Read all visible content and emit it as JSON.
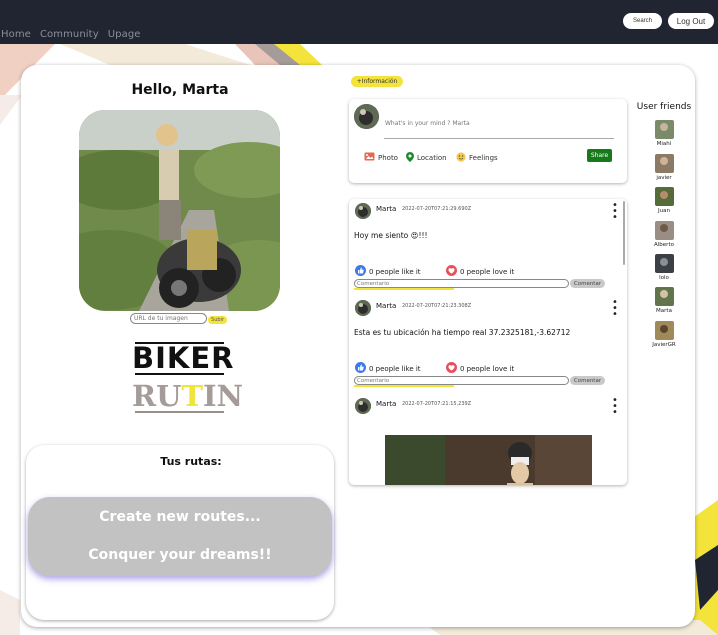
{
  "nav": {
    "links": [
      "Home",
      "Community",
      "Upage"
    ],
    "search_label": "Search",
    "logout_label": "Log Out"
  },
  "profile": {
    "greeting": "Hello, Marta",
    "url_placeholder": "URL de tu imagen",
    "upload_label": "Subir",
    "logo_top": "BIKER",
    "logo_bottom_a": "RU",
    "logo_bottom_b": "T",
    "logo_bottom_c": "IN"
  },
  "routes": {
    "title": "Tus rutas:",
    "cta_line1": "Create new routes...",
    "cta_line2": "Conquer your dreams!!"
  },
  "composer": {
    "info_label": "+Información",
    "placeholder": "What's in your mind ? Marta",
    "photo_label": "Photo",
    "location_label": "Location",
    "feelings_label": "Feelings",
    "share_label": "Share"
  },
  "posts": [
    {
      "author": "Marta",
      "date": "2022-07-20T07:21:29.690Z",
      "text": "Hoy me siento 😍!!!",
      "likes": "0 people like it",
      "loves": "0 people love it",
      "comment_placeholder": "Comentario",
      "comment_button": "Comentar"
    },
    {
      "author": "Marta",
      "date": "2022-07-20T07:21:23.308Z",
      "text": "Esta es tu ubicación ha tiempo real 37.2325181,-3.62712",
      "likes": "0 people like it",
      "loves": "0 people love it",
      "comment_placeholder": "Comentario",
      "comment_button": "Comentar"
    },
    {
      "author": "Marta",
      "date": "2022-07-20T07:21:15.239Z"
    }
  ],
  "friends": {
    "title": "User friends",
    "list": [
      "Miahi",
      "javier",
      "Juan",
      "Alberto",
      "lolo",
      "Marta",
      "JavierGR"
    ]
  },
  "colors": {
    "topbar": "#202531",
    "accent_yellow": "#f3e33a",
    "share_green": "#167a1a",
    "cta_gray": "#c2c2c2"
  }
}
